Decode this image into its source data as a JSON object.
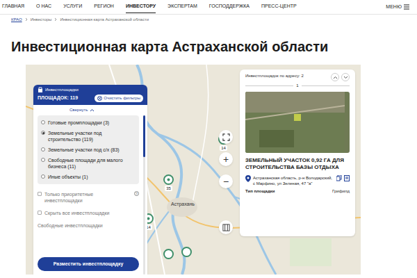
{
  "nav": {
    "items": [
      {
        "label": "ГЛАВНАЯ",
        "selected": false
      },
      {
        "label": "О НАС",
        "selected": false
      },
      {
        "label": "УСЛУГИ",
        "selected": false
      },
      {
        "label": "РЕГИОН",
        "selected": false
      },
      {
        "label": "ИНВЕСТОРУ",
        "selected": true
      },
      {
        "label": "ЭКСПЕРТАМ",
        "selected": false
      },
      {
        "label": "ГОСПОДДЕРЖКА",
        "selected": false
      },
      {
        "label": "ПРЕСС-ЦЕНТР",
        "selected": false
      }
    ],
    "menu": "МЕНЮ"
  },
  "breadcrumbs": [
    "КРАО",
    "Инвесторы",
    "Инвестиционная карта Астраханской области"
  ],
  "title": "Инвестиционная карта Астраханской области",
  "filter_panel": {
    "tab": "Инвестплощадки",
    "count": "ПЛОЩАДОК: 119",
    "clear": "Очистить фильтры",
    "collapse": "Свернуть",
    "types": [
      {
        "label": "Готовые промплощадки (3)",
        "selected": false
      },
      {
        "label": "Земельные участки под строительство (119)",
        "selected": true
      },
      {
        "label": "Земельные участки под с/х (83)",
        "selected": false
      },
      {
        "label": "Свободные площади для малого бизнеса (11)",
        "selected": false
      },
      {
        "label": "Иные объекты (1)",
        "selected": false
      }
    ],
    "options": [
      {
        "label": "Только приоритетные инвестплощадки",
        "checked": false,
        "help": "?"
      },
      {
        "label": "Скрыть все инвестплощадки",
        "checked": false,
        "help": ""
      }
    ],
    "section": "Свободные инвестплощадки",
    "button": "Разместить инвестплощадку"
  },
  "map": {
    "city": "Астрахань",
    "zoom_in": "+",
    "zoom_out": "−",
    "clusters": [
      {
        "count": "14"
      },
      {
        "count": "35"
      },
      {
        "count": "14"
      }
    ]
  },
  "card_panel": {
    "header": "Инвестплощадок по адресу: 2",
    "page": "1",
    "title": "ЗЕМЕЛЬНЫЙ УЧАСТОК 0,92 ГА ДЛЯ СТРОИТЕЛЬСТВА БАЗЫ ОТДЫХА",
    "address": "Астраханская область, р-н Володарский, с Марфино, ул Зеленая, 47 \"а\"",
    "type_label": "Тип площадки",
    "type_value": "Грифилд"
  }
}
